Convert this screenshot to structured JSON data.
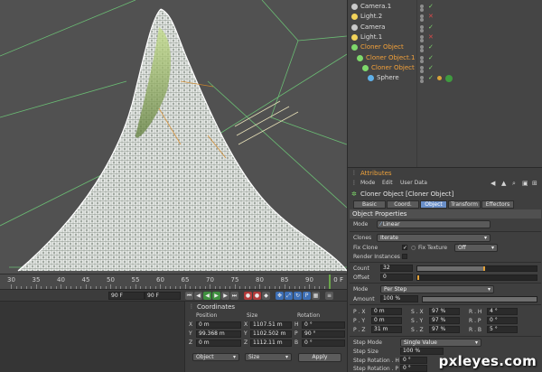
{
  "timeline": {
    "ticks": [
      "30",
      "35",
      "40",
      "45",
      "50",
      "55",
      "60",
      "65",
      "70",
      "75",
      "80",
      "85",
      "90"
    ],
    "current_frame": "0 F",
    "start_field": "90 F",
    "end_field": "90 F"
  },
  "objects": {
    "items": [
      {
        "name": "Camera.1",
        "indent": 0,
        "active": false
      },
      {
        "name": "Light.2",
        "indent": 0,
        "active": false
      },
      {
        "name": "Camera",
        "indent": 0,
        "active": false
      },
      {
        "name": "Light.1",
        "indent": 0,
        "active": false
      },
      {
        "name": "Cloner Object",
        "indent": 0,
        "active": true
      },
      {
        "name": "Cloner Object.1",
        "indent": 1,
        "active": true
      },
      {
        "name": "Cloner Object",
        "indent": 2,
        "active": true
      },
      {
        "name": "Sphere",
        "indent": 3,
        "active": false
      }
    ]
  },
  "attributes": {
    "title": "Attributes",
    "menu": [
      "Mode",
      "Edit",
      "User Data"
    ],
    "object_name": "Cloner Object [Cloner Object]",
    "tabs": [
      "Basic",
      "Coord.",
      "Object",
      "Transform",
      "Effectors"
    ],
    "active_tab": "Object",
    "section": "Object Properties",
    "mode_label": "Mode",
    "mode_value": "Linear",
    "clones_label": "Clones",
    "clones_value": "Iterate",
    "fix_clone_label": "Fix Clone",
    "fix_texture_label": "Fix Texture",
    "fix_texture_value": "Off",
    "render_instances_label": "Render Instances",
    "count_label": "Count",
    "count_value": "32",
    "count_fraction": 0.55,
    "offset_label": "Offset",
    "offset_value": "0",
    "mode2_label": "Mode",
    "mode2_value": "Per Step",
    "amount_label": "Amount",
    "amount_value": "100 %",
    "p_rows": [
      {
        "p": "P . X",
        "pv": "0 m",
        "s": "S . X",
        "sv": "97 %",
        "r": "R . H",
        "rv": "4 °"
      },
      {
        "p": "P . Y",
        "pv": "0 m",
        "s": "S . Y",
        "sv": "97 %",
        "r": "R . P",
        "rv": "0 °"
      },
      {
        "p": "P . Z",
        "pv": "31 m",
        "s": "S . Z",
        "sv": "97 %",
        "r": "R . B",
        "rv": "5 °"
      }
    ],
    "step_mode_label": "Step Mode",
    "step_mode_value": "Single Value",
    "step_size_label": "Step Size",
    "step_size_value": "100 %",
    "step_rot_h_label": "Step Rotation . H",
    "step_rot_h_value": "0 °",
    "step_rot_p_label": "Step Rotation . P",
    "step_rot_p_value": "0 °"
  },
  "coordinates": {
    "title": "Coordinates",
    "headers": [
      "Position",
      "Size",
      "Rotation"
    ],
    "rows": [
      {
        "axis": "X",
        "pos": "0 m",
        "size_axis": "X",
        "size": "1107.51 m",
        "rot_axis": "H",
        "rot": "0 °"
      },
      {
        "axis": "Y",
        "pos": "99.368 m",
        "size_axis": "Y",
        "size": "1102.502 m",
        "rot_axis": "P",
        "rot": "90 °"
      },
      {
        "axis": "Z",
        "pos": "0 m",
        "size_axis": "Z",
        "size": "1112.11 m",
        "rot_axis": "B",
        "rot": "0 °"
      }
    ],
    "dropdown_object": "Object",
    "dropdown_size": "Size",
    "apply_label": "Apply"
  },
  "watermark": "pxleyes.com",
  "colors": {
    "active_object": "#f3a13a",
    "tab_active": "#6a8fc8",
    "check_green": "#7ed96b",
    "mesh_white": "#ffffff",
    "guide_green": "#6fcf7a"
  }
}
